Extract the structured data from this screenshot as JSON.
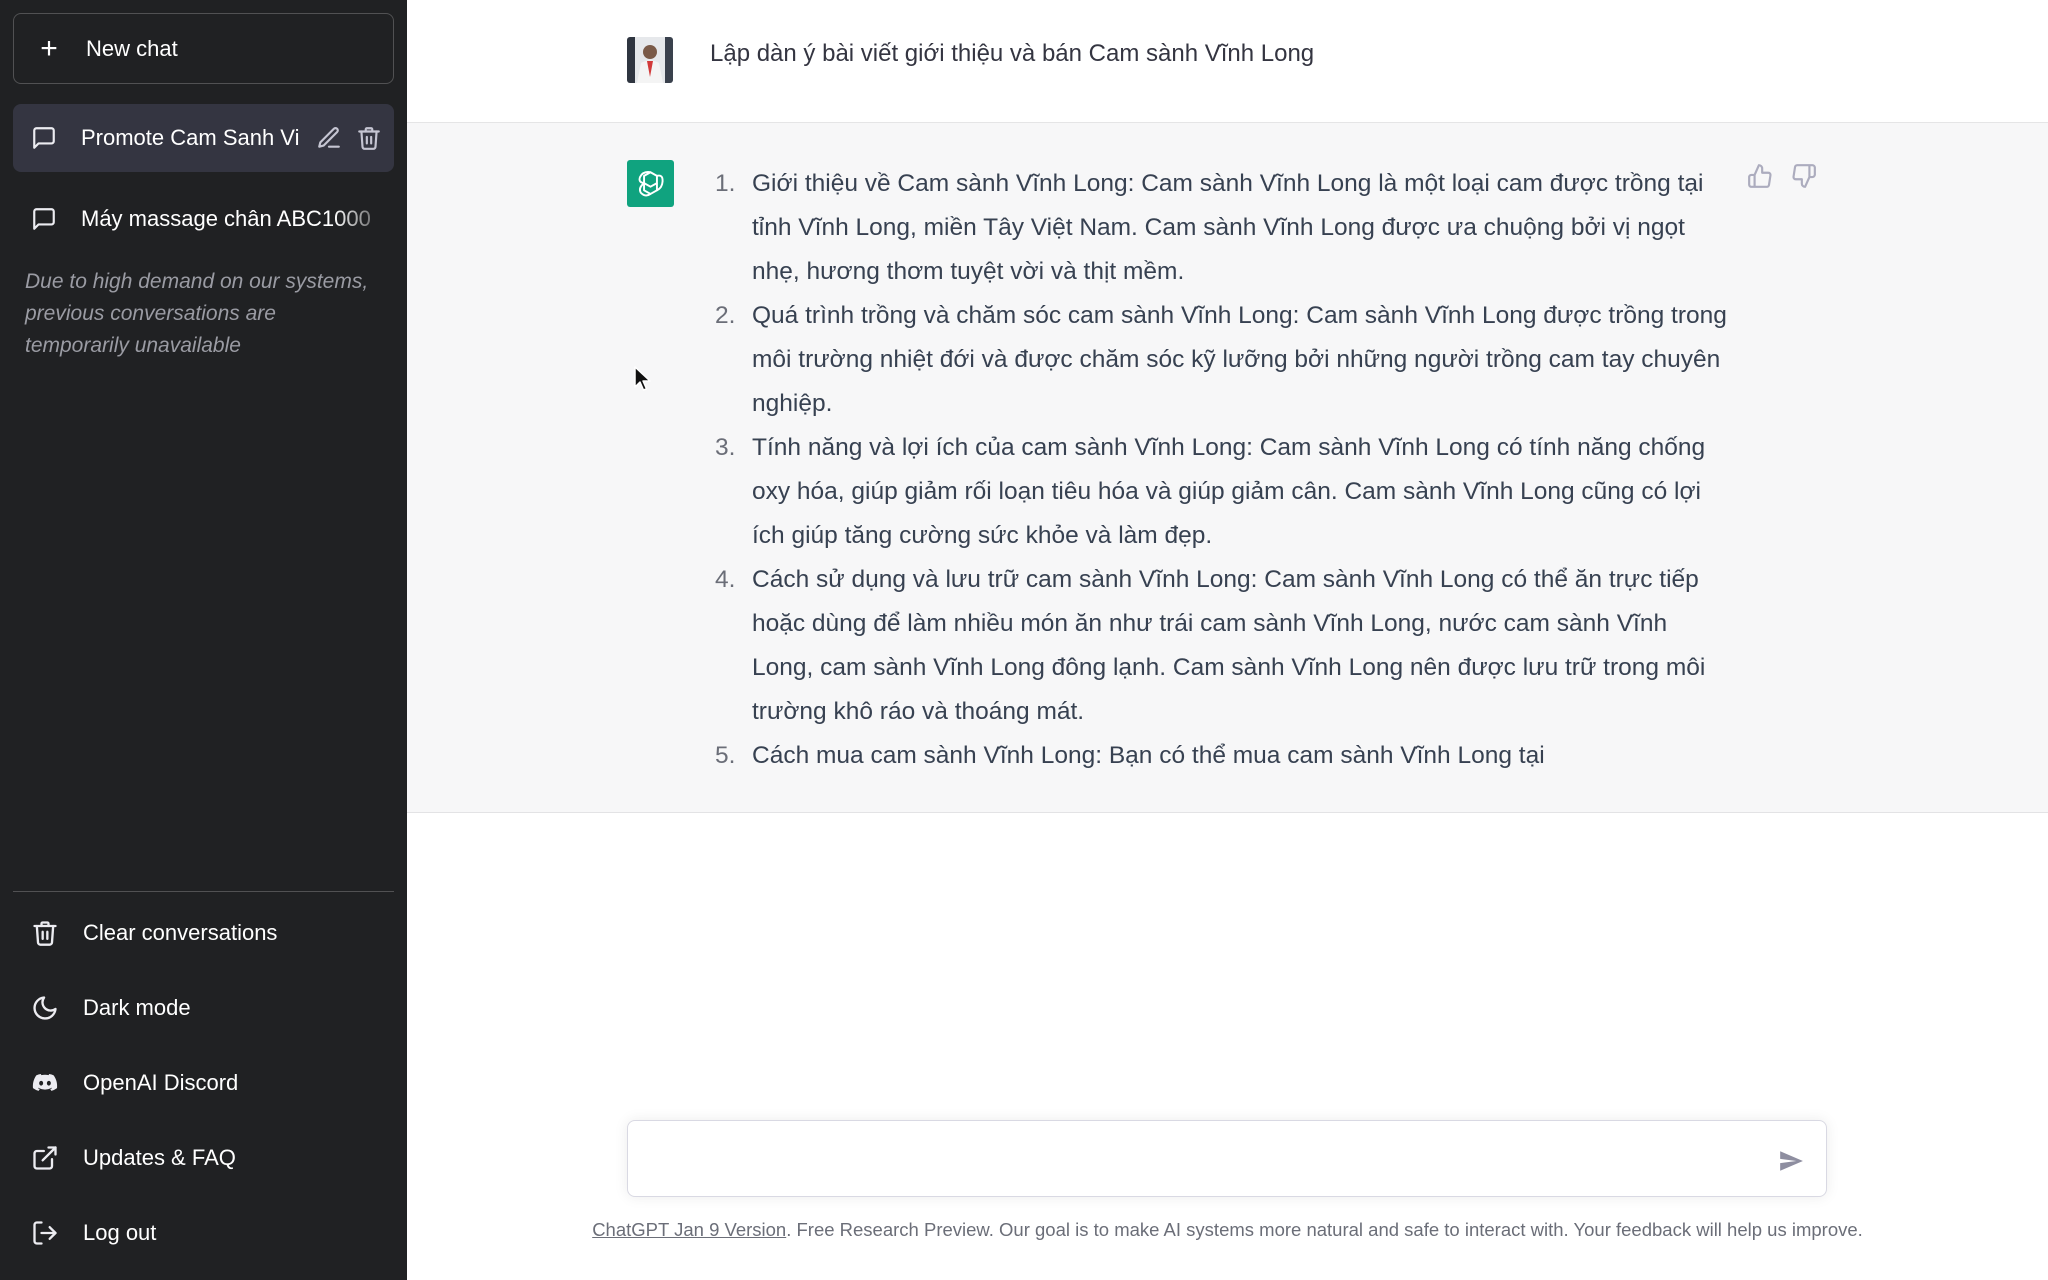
{
  "sidebar": {
    "new_chat_label": "New chat",
    "conversations": [
      {
        "label": "Promote Cam Sanh Vi",
        "active": true
      },
      {
        "label": "Máy massage chân ABC1000",
        "active": false
      }
    ],
    "notice": "Due to high demand on our systems, previous conversations are temporarily unavailable",
    "menu": [
      {
        "label": "Clear conversations",
        "icon": "trash-icon"
      },
      {
        "label": "Dark mode",
        "icon": "moon-icon"
      },
      {
        "label": "OpenAI Discord",
        "icon": "discord-icon"
      },
      {
        "label": "Updates & FAQ",
        "icon": "external-link-icon"
      },
      {
        "label": "Log out",
        "icon": "logout-icon"
      }
    ]
  },
  "chat": {
    "user_message": "Lập dàn ý bài viết giới thiệu và bán Cam sành Vĩnh Long",
    "assistant_items": [
      {
        "num": "1.",
        "text": "Giới thiệu về Cam sành Vĩnh Long: Cam sành Vĩnh Long là một loại cam được trồng tại tỉnh Vĩnh Long, miền Tây Việt Nam. Cam sành Vĩnh Long được ưa chuộng bởi vị ngọt nhẹ, hương thơm tuyệt vời và thịt mềm."
      },
      {
        "num": "2.",
        "text": "Quá trình trồng và chăm sóc cam sành Vĩnh Long: Cam sành Vĩnh Long được trồng trong môi trường nhiệt đới và được chăm sóc kỹ lưỡng bởi những người trồng cam tay chuyên nghiệp."
      },
      {
        "num": "3.",
        "text": "Tính năng và lợi ích của cam sành Vĩnh Long: Cam sành Vĩnh Long có tính năng chống oxy hóa, giúp giảm rối loạn tiêu hóa và giúp giảm cân. Cam sành Vĩnh Long cũng có lợi ích giúp tăng cường sức khỏe và làm đẹp."
      },
      {
        "num": "4.",
        "text": "Cách sử dụng và lưu trữ cam sành Vĩnh Long: Cam sành Vĩnh Long có thể ăn trực tiếp hoặc dùng để làm nhiều món ăn như trái cam sành Vĩnh Long, nước cam sành Vĩnh Long, cam sành Vĩnh Long đông lạnh. Cam sành Vĩnh Long nên được lưu trữ trong môi trường khô ráo và thoáng mát."
      },
      {
        "num": "5.",
        "text": "Cách mua cam sành Vĩnh Long: Bạn có thể mua cam sành Vĩnh Long tại"
      }
    ]
  },
  "composer": {
    "value": "",
    "placeholder": ""
  },
  "footer": {
    "link": "ChatGPT Jan 9 Version",
    "text": ". Free Research Preview. Our goal is to make AI systems more natural and safe to interact with. Your feedback will help us improve."
  },
  "colors": {
    "sidebar_bg": "#202123",
    "active_conv_bg": "#343541",
    "assistant_bg": "#f7f7f8",
    "brand": "#10a37f"
  }
}
